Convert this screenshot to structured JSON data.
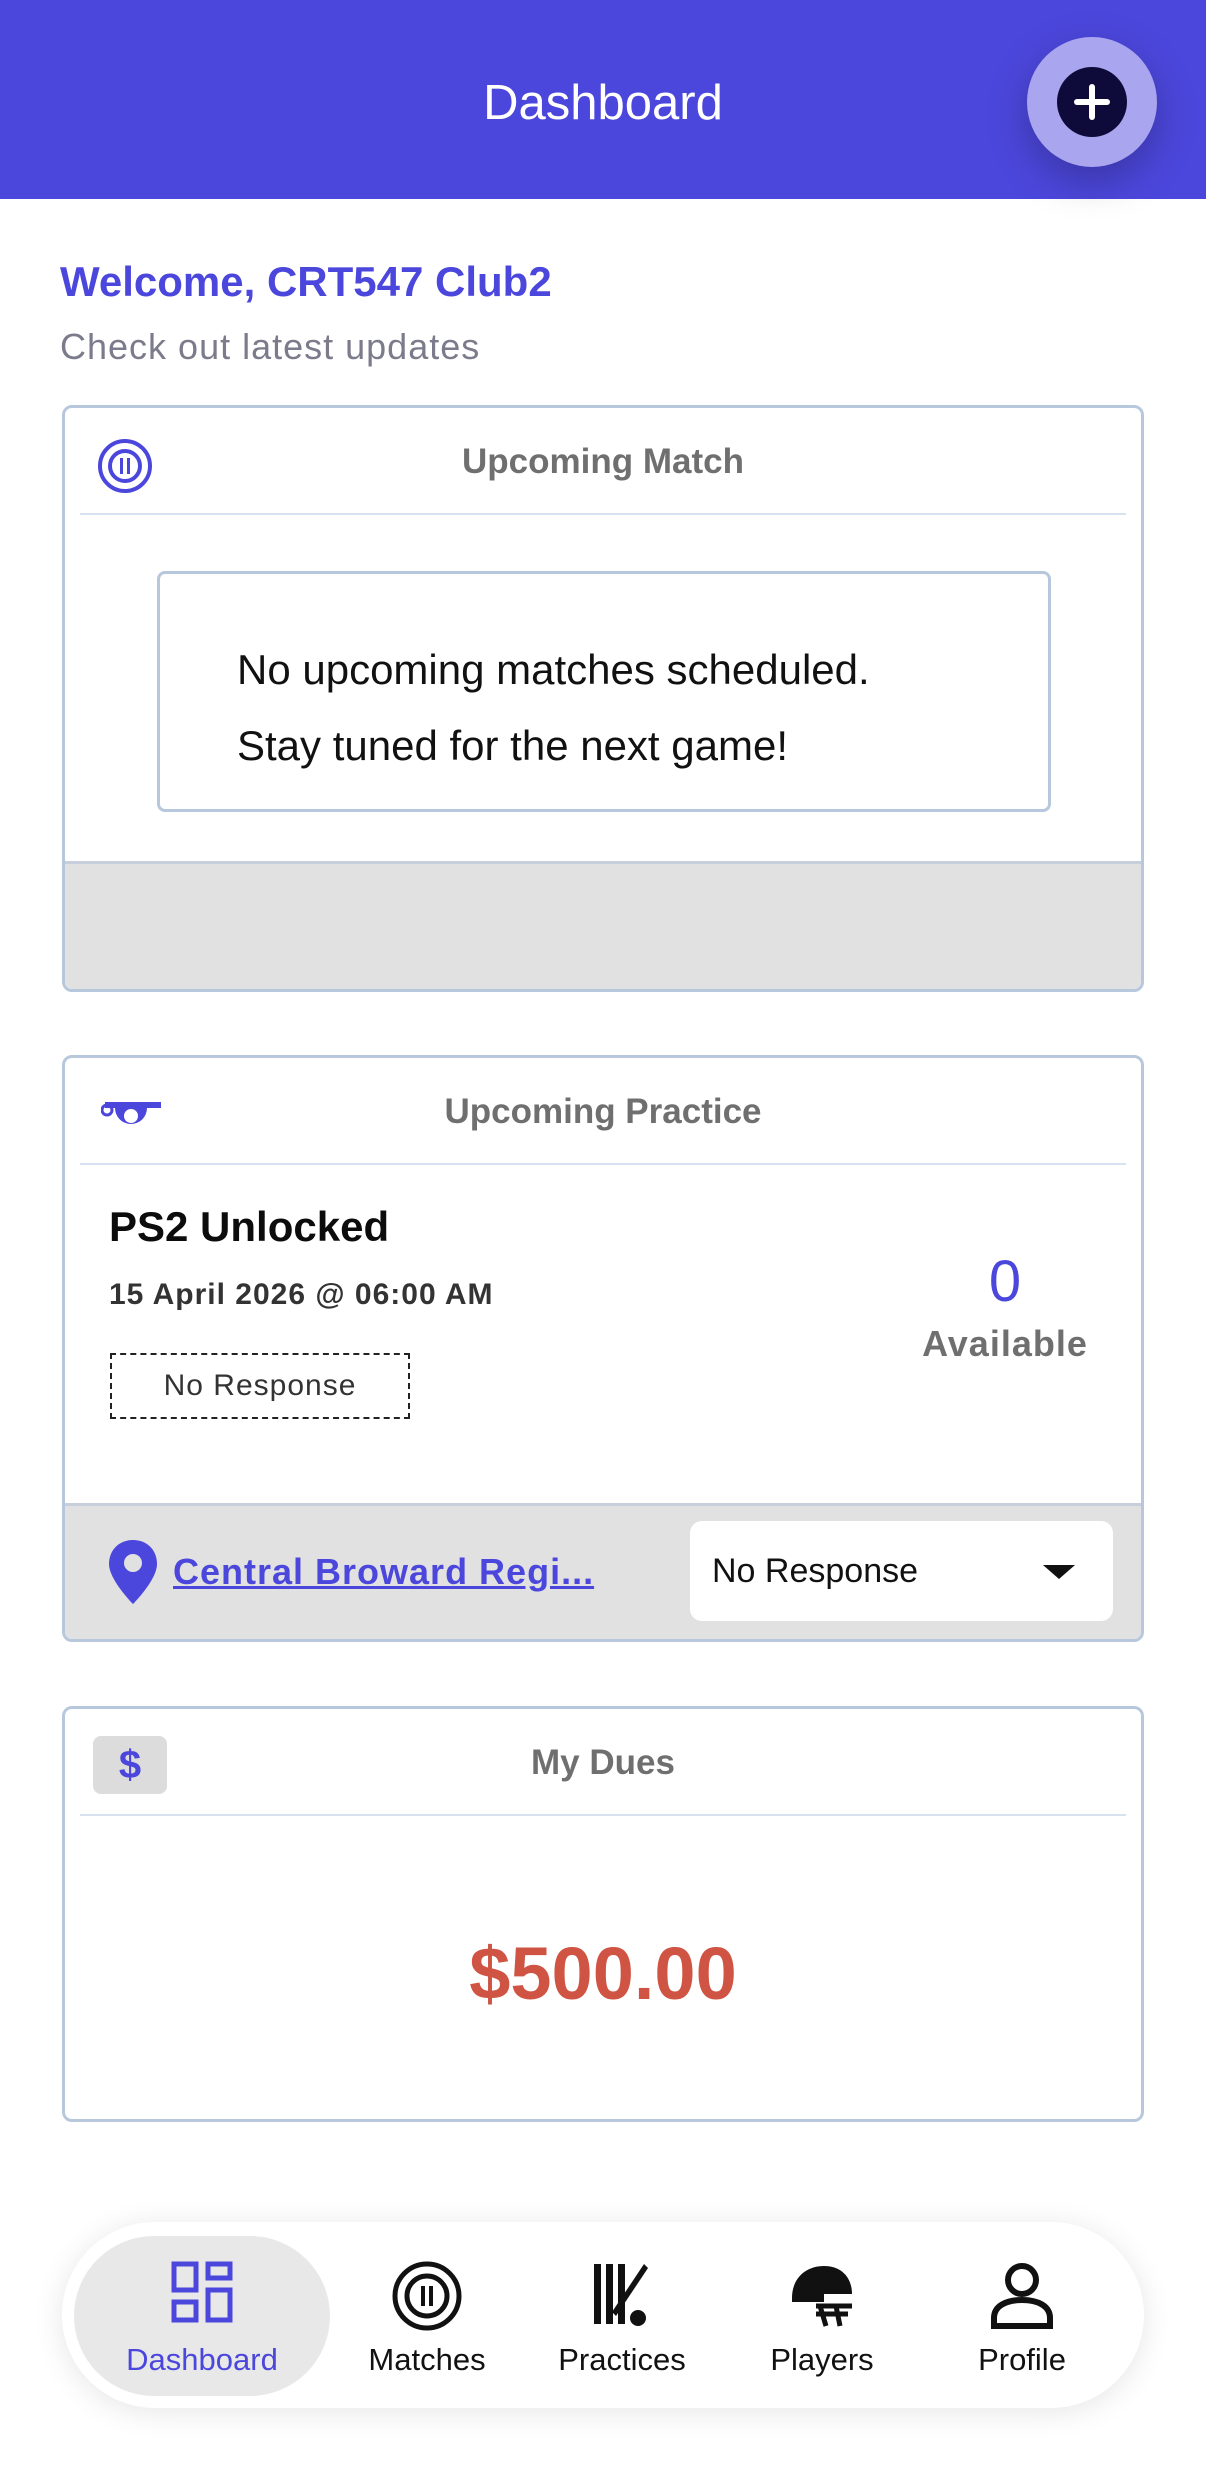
{
  "header": {
    "title": "Dashboard",
    "add_icon": "plus-circle-icon"
  },
  "welcome": {
    "title": "Welcome, CRT547 Club2",
    "subtitle": "Check out latest updates"
  },
  "upcoming_match": {
    "title": "Upcoming Match",
    "icon": "ball-target-icon",
    "message_line1": "No upcoming matches scheduled.",
    "message_line2": "Stay tuned for the next game!"
  },
  "upcoming_practice": {
    "title": "Upcoming Practice",
    "icon": "whistle-icon",
    "name": "PS2 Unlocked",
    "datetime": "15 April 2026 @ 06:00 AM",
    "status": "No Response",
    "available_count": "0",
    "available_label": "Available",
    "location": "Central Broward Regi...",
    "response_select": "No Response"
  },
  "dues": {
    "title": "My Dues",
    "icon": "dollar-icon",
    "amount": "$500.00"
  },
  "nav": {
    "items": [
      {
        "label": "Dashboard",
        "icon": "dashboard-grid-icon",
        "active": true
      },
      {
        "label": "Matches",
        "icon": "ball-target-icon"
      },
      {
        "label": "Practices",
        "icon": "cricket-bat-icon"
      },
      {
        "label": "Players",
        "icon": "helmet-icon"
      },
      {
        "label": "Profile",
        "icon": "person-icon"
      }
    ]
  },
  "colors": {
    "primary": "#4c47dc",
    "dues": "#cf5443",
    "footer": "#e1e1e1"
  }
}
